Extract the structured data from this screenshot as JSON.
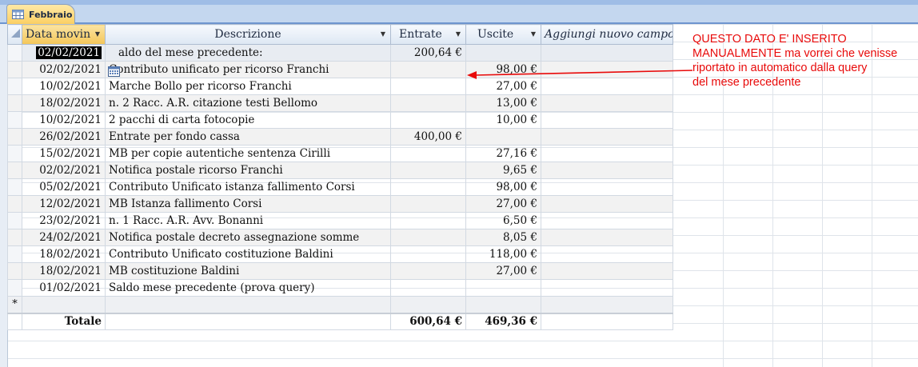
{
  "tab": {
    "label": "Febbraio",
    "icon": "table-icon"
  },
  "columns": [
    {
      "label": "Data movin",
      "has_dropdown": true,
      "selected": true
    },
    {
      "label": "Descrizione",
      "has_dropdown": true
    },
    {
      "label": "Entrate",
      "has_dropdown": true
    },
    {
      "label": "Uscite",
      "has_dropdown": true
    },
    {
      "label": "Aggiungi nuovo campo",
      "has_dropdown": false
    }
  ],
  "rows": [
    {
      "date": "02/02/2021",
      "desc": "aldo del mese precedente:",
      "entrate": "200,64 €",
      "uscite": ""
    },
    {
      "date": "02/02/2021",
      "desc": "Contributo unificato per ricorso Franchi",
      "entrate": "",
      "uscite": "98,00 €"
    },
    {
      "date": "10/02/2021",
      "desc": "Marche Bollo per ricorso Franchi",
      "entrate": "",
      "uscite": "27,00 €"
    },
    {
      "date": "18/02/2021",
      "desc": "n. 2 Racc. A.R. citazione testi Bellomo",
      "entrate": "",
      "uscite": "13,00 €"
    },
    {
      "date": "10/02/2021",
      "desc": "2 pacchi di carta fotocopie",
      "entrate": "",
      "uscite": "10,00 €"
    },
    {
      "date": "26/02/2021",
      "desc": "Entrate per fondo cassa",
      "entrate": "400,00 €",
      "uscite": ""
    },
    {
      "date": "15/02/2021",
      "desc": "MB per copie autentiche sentenza Cirilli",
      "entrate": "",
      "uscite": "27,16 €"
    },
    {
      "date": "02/02/2021",
      "desc": "Notifica postale ricorso Franchi",
      "entrate": "",
      "uscite": "9,65 €"
    },
    {
      "date": "05/02/2021",
      "desc": "Contributo Unificato istanza fallimento Corsi",
      "entrate": "",
      "uscite": "98,00 €"
    },
    {
      "date": "12/02/2021",
      "desc": "MB Istanza fallimento Corsi",
      "entrate": "",
      "uscite": "27,00 €"
    },
    {
      "date": "23/02/2021",
      "desc": "n. 1 Racc. A.R. Avv. Bonanni",
      "entrate": "",
      "uscite": "6,50 €"
    },
    {
      "date": "24/02/2021",
      "desc": "Notifica postale decreto assegnazione somme",
      "entrate": "",
      "uscite": "8,05 €"
    },
    {
      "date": "18/02/2021",
      "desc": "Contributo Unificato costituzione Baldini",
      "entrate": "",
      "uscite": "118,00 €"
    },
    {
      "date": "18/02/2021",
      "desc": "MB costituzione Baldini",
      "entrate": "",
      "uscite": "27,00 €"
    },
    {
      "date": "01/02/2021",
      "desc": "Saldo mese precedente (prova query)",
      "entrate": "",
      "uscite": ""
    }
  ],
  "new_record_marker": "*",
  "totals": {
    "label": "Totale",
    "entrate": "600,64 €",
    "uscite": "469,36 €"
  },
  "annotation": {
    "lines": [
      "QUESTO DATO E' INSERITO",
      "MANUALMENTE ma vorrei che venisse",
      "riportato in automatico dalla query",
      "del mese precedente"
    ],
    "color": "#e80a0a"
  },
  "colors": {
    "selected_header": "#f4c659",
    "ribbon": "#c4d7ef"
  }
}
